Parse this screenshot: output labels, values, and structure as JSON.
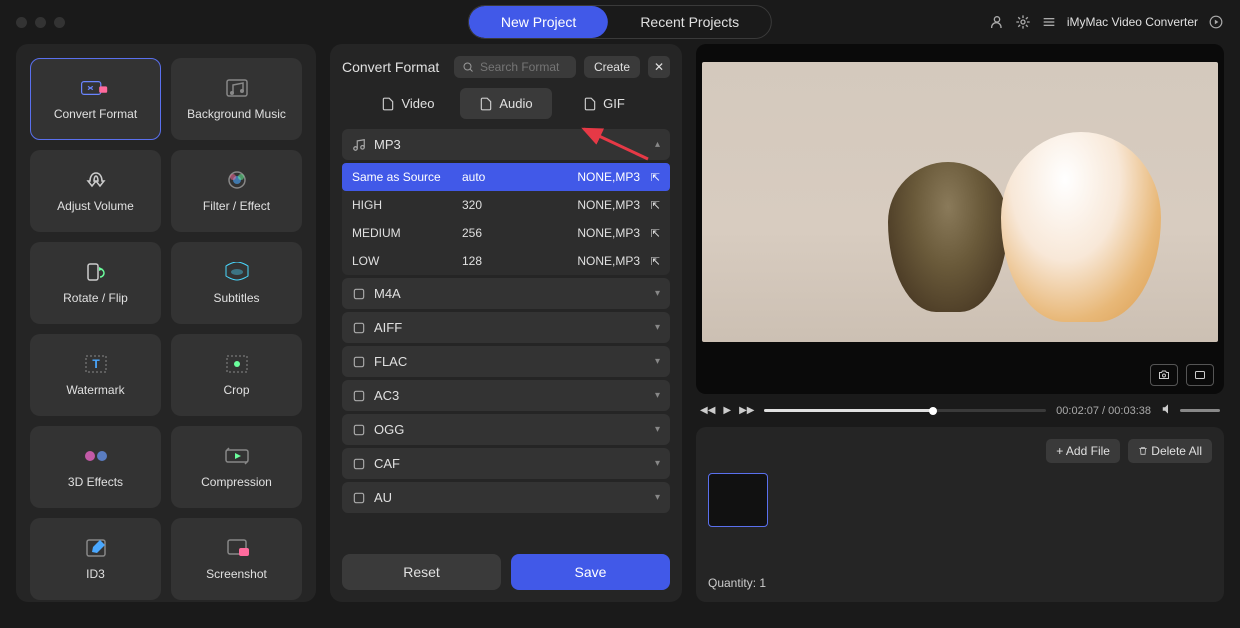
{
  "app": {
    "title": "iMyMac Video Converter"
  },
  "nav": {
    "new_project": "New Project",
    "recent": "Recent Projects"
  },
  "tools": [
    {
      "label": "Convert Format",
      "active": true
    },
    {
      "label": "Background Music",
      "active": false
    },
    {
      "label": "Adjust Volume",
      "active": false
    },
    {
      "label": "Filter / Effect",
      "active": false
    },
    {
      "label": "Rotate / Flip",
      "active": false
    },
    {
      "label": "Subtitles",
      "active": false
    },
    {
      "label": "Watermark",
      "active": false
    },
    {
      "label": "Crop",
      "active": false
    },
    {
      "label": "3D Effects",
      "active": false
    },
    {
      "label": "Compression",
      "active": false
    },
    {
      "label": "ID3",
      "active": false
    },
    {
      "label": "Screenshot",
      "active": false
    }
  ],
  "format": {
    "title": "Convert Format",
    "search_placeholder": "Search Format",
    "create": "Create",
    "tabs": {
      "video": "Video",
      "audio": "Audio",
      "gif": "GIF"
    },
    "mp3": {
      "label": "MP3",
      "presets": [
        {
          "name": "Same as Source",
          "bitrate": "auto",
          "codec": "NONE,MP3",
          "sel": true
        },
        {
          "name": "HIGH",
          "bitrate": "320",
          "codec": "NONE,MP3",
          "sel": false
        },
        {
          "name": "MEDIUM",
          "bitrate": "256",
          "codec": "NONE,MP3",
          "sel": false
        },
        {
          "name": "LOW",
          "bitrate": "128",
          "codec": "NONE,MP3",
          "sel": false
        }
      ]
    },
    "groups": [
      "M4A",
      "AIFF",
      "FLAC",
      "AC3",
      "OGG",
      "CAF",
      "AU"
    ],
    "reset": "Reset",
    "save": "Save"
  },
  "player": {
    "cur": "00:02:07",
    "dur": "00:03:38"
  },
  "queue": {
    "add": "+ Add File",
    "delete": "Delete All",
    "qty_label": "Quantity: ",
    "qty": "1"
  }
}
